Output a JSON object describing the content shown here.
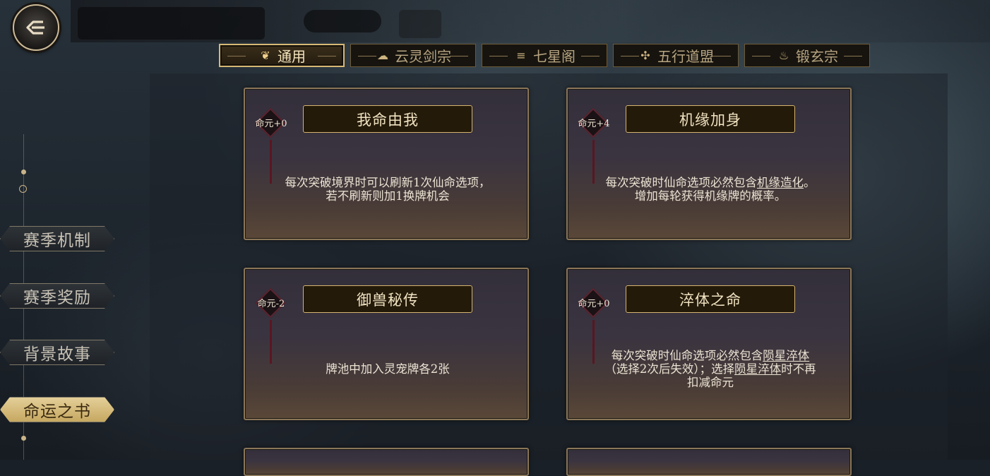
{
  "tabs": [
    {
      "label": "通用",
      "icon": "leaf-icon",
      "active": true
    },
    {
      "label": "云灵剑宗",
      "icon": "cloud-sword-icon",
      "active": false
    },
    {
      "label": "七星阁",
      "icon": "pagoda-icon",
      "active": false
    },
    {
      "label": "五行道盟",
      "icon": "five-elements-icon",
      "active": false
    },
    {
      "label": "锻玄宗",
      "icon": "forge-flame-icon",
      "active": false
    }
  ],
  "side_nav": [
    {
      "label": "赛季机制",
      "active": false
    },
    {
      "label": "赛季奖励",
      "active": false
    },
    {
      "label": "背景故事",
      "active": false
    },
    {
      "label": "命运之书",
      "active": true
    }
  ],
  "cards": [
    {
      "title": "我命由我",
      "cost": "命元+0",
      "desc": [
        {
          "t": "每次突破境界时可以刷新1次仙命选项，若不刷新则加1换牌机会",
          "u": false
        }
      ]
    },
    {
      "title": "机缘加身",
      "cost": "命元+4",
      "desc": [
        {
          "t": "每次突破时仙命选项必然包含",
          "u": false
        },
        {
          "t": "机缘造化",
          "u": true
        },
        {
          "t": "。增加每轮获得机缘牌的概率。",
          "u": false
        }
      ]
    },
    {
      "title": "御兽秘传",
      "cost": "命元-2",
      "desc": [
        {
          "t": "牌池中加入灵宠牌各2张",
          "u": false
        }
      ]
    },
    {
      "title": "淬体之命",
      "cost": "命元+0",
      "desc": [
        {
          "t": "每次突破时仙命选项必然包含",
          "u": false
        },
        {
          "t": "陨星淬体",
          "u": true
        },
        {
          "t": "（选择2次后失效）；选择",
          "u": false
        },
        {
          "t": "陨星淬体",
          "u": true
        },
        {
          "t": "时不再扣减命元",
          "u": false
        }
      ]
    }
  ],
  "colors": {
    "gold_border": "#d7b874",
    "card_title_bg": "#241a09",
    "cost_diamond": "#5b2430",
    "active_nav": "#e4cf98"
  }
}
